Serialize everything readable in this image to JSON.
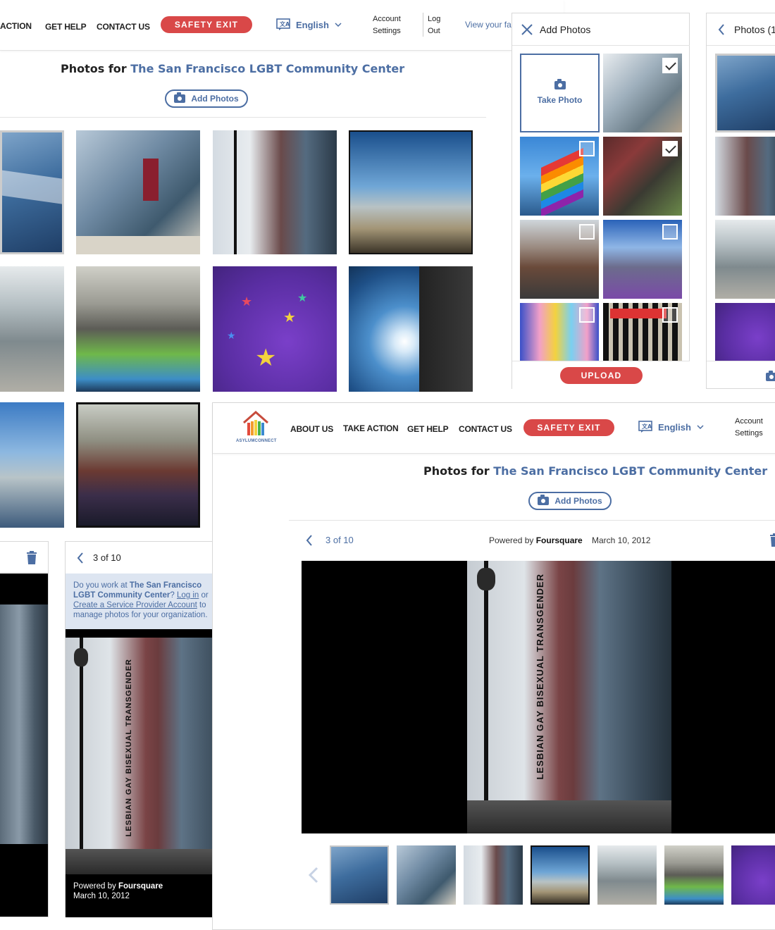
{
  "bg_nav": {
    "items": [
      "ACTION",
      "GET HELP",
      "CONTACT US"
    ],
    "safety_exit": "SAFETY EXIT",
    "language": "English",
    "account": [
      "Account",
      "Settings"
    ],
    "logout": [
      "Log",
      "Out"
    ],
    "view_favorites": "View your fa"
  },
  "bg_page": {
    "title_prefix": "Photos for",
    "org_name": "The San Francisco LGBT Community Center",
    "add_photos": "Add Photos"
  },
  "add_panel": {
    "title": "Add Photos",
    "take_photo": "Take Photo",
    "upload": "UPLOAD",
    "checks": [
      true,
      false,
      true,
      false,
      false,
      false,
      false
    ]
  },
  "right_panel": {
    "title": "Photos (1"
  },
  "front": {
    "logo_text": "ASYLUMCONNECT",
    "nav": [
      "ABOUT US",
      "TAKE ACTION",
      "GET HELP",
      "CONTACT US"
    ],
    "safety_exit": "SAFETY EXIT",
    "language": "English",
    "account": [
      "Account",
      "Settings"
    ],
    "title_prefix": "Photos for",
    "org_name": "The San Francisco LGBT Community Center",
    "add_photos": "Add Photos",
    "counter": "3 of 10",
    "powered_by": "Powered by",
    "provider": "Foursquare",
    "date": "March 10, 2012"
  },
  "mobile": {
    "counter": "3 of 10",
    "notice_pre": "Do you work at",
    "notice_org": "The San Francisco LGBT Community Center",
    "notice_q": "?",
    "login": "Log in",
    "or": "or",
    "create": "Create a Service Provider Account",
    "notice_post": "to manage photos for your organization.",
    "powered_by": "Powered by",
    "provider": "Foursquare",
    "date": "March 10, 2012"
  },
  "colors": {
    "accent": "#4c6ea3",
    "safety": "#d94848",
    "banner": "#dde5f1"
  },
  "icons": [
    "translate-icon",
    "chevron-down-icon",
    "camera-icon",
    "close-icon",
    "chevron-left-icon",
    "trash-icon",
    "checkbox-icon"
  ]
}
